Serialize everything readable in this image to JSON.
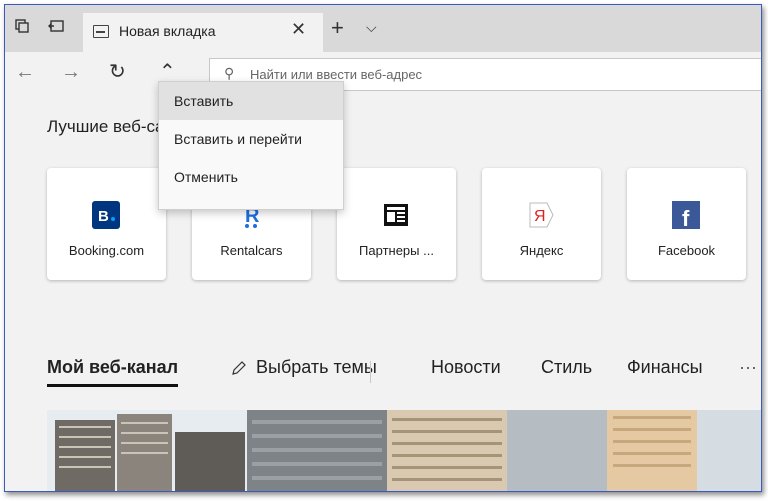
{
  "tabbar": {
    "tab_title": "Новая вкладка",
    "close_glyph": "✕",
    "new_tab_glyph": "+",
    "tab_list_glyph": "⌵",
    "icons": [
      "tab-actions-icon",
      "tab-aside-icon"
    ]
  },
  "navbar": {
    "back_glyph": "←",
    "forward_glyph": "→",
    "refresh_glyph": "↻",
    "collapse_glyph": "⌃",
    "address_placeholder": "Найти или ввести веб-адрес",
    "search_glyph": "⚲"
  },
  "context_menu": {
    "items": [
      {
        "label": "Вставить",
        "highlighted": true
      },
      {
        "label": "Вставить и перейти",
        "highlighted": false
      },
      {
        "label": "Отменить",
        "highlighted": false
      }
    ]
  },
  "top_sites": {
    "title": "Лучшие веб-сайты",
    "tiles": [
      {
        "label": "Booking.com",
        "icon": "booking-icon",
        "color": "#003580",
        "glyph": "B."
      },
      {
        "label": "Rentalcars",
        "icon": "rentalcars-icon",
        "color": "#1d6fe0",
        "glyph": "R"
      },
      {
        "label": "Партнеры ...",
        "icon": "news-icon",
        "color": "#111111",
        "glyph": ""
      },
      {
        "label": "Яндекс",
        "icon": "yandex-icon",
        "color": "#e02020",
        "glyph": "Я"
      },
      {
        "label": "Facebook",
        "icon": "facebook-icon",
        "color": "#3b5998",
        "glyph": "f"
      }
    ]
  },
  "feed": {
    "active_tab": "Мой веб-канал",
    "choose_topics": "Выбрать темы",
    "tabs": [
      "Новости",
      "Стиль",
      "Финансы"
    ],
    "more_glyph": "···"
  },
  "colors": {
    "accent": "#3a5bbd",
    "background": "#f2f2f2",
    "tabbar": "#d9d9d9"
  }
}
